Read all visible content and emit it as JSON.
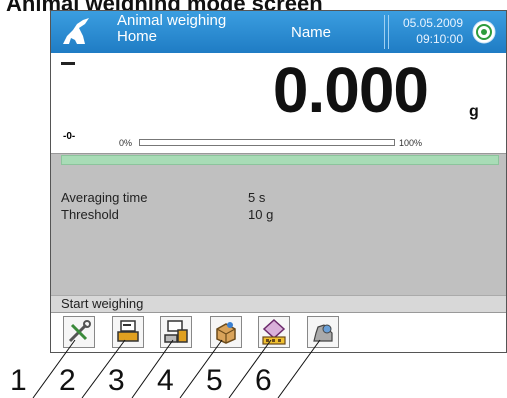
{
  "document": {
    "title": "Animal weighing mode screen"
  },
  "header": {
    "mode_line1": "Animal weighing",
    "mode_line2": "Home",
    "user": "Name",
    "date": "05.05.2009",
    "time": "09:10:00",
    "accent": "#1f7cc4"
  },
  "display": {
    "value": "0.000",
    "unit": "g",
    "zero_indicator": "-0-",
    "bar_min_label": "0%",
    "bar_max_label": "100%",
    "bar_fill_fraction": 0
  },
  "info": {
    "progress_color": "#a8dcb6",
    "rows": [
      {
        "label": "Averaging time",
        "value": "5 s"
      },
      {
        "label": "Threshold",
        "value": "10 g"
      }
    ]
  },
  "status": {
    "text": "Start weighing"
  },
  "toolbar": {
    "buttons": [
      {
        "icon": "tools-icon"
      },
      {
        "icon": "tare-icon"
      },
      {
        "icon": "tare-product-icon"
      },
      {
        "icon": "product-icon"
      },
      {
        "icon": "packaging-icon"
      },
      {
        "icon": "animal-icon"
      }
    ]
  },
  "callouts": [
    "1",
    "2",
    "3",
    "4",
    "5",
    "6"
  ]
}
